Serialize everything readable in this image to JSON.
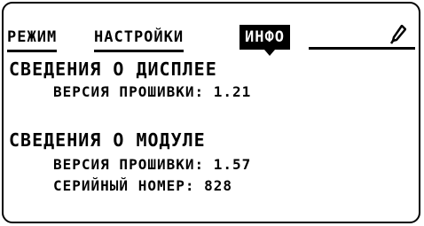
{
  "tabs": [
    {
      "label": "РЕЖИМ"
    },
    {
      "label": "НАСТРОЙКИ"
    },
    {
      "label": "ИНФО"
    }
  ],
  "display": {
    "heading": "СВЕДЕНИЯ О ДИСПЛЕЕ",
    "firmware": "ВЕРСИЯ ПРОШИВКИ: 1.21"
  },
  "module": {
    "heading": "СВЕДЕНИЯ О МОДУЛЕ",
    "firmware": "ВЕРСИЯ ПРОШИВКИ: 1.57",
    "serial": "СЕРИЙНЫЙ НОМЕР: 828"
  },
  "icons": {
    "top_right": "pen-icon"
  }
}
